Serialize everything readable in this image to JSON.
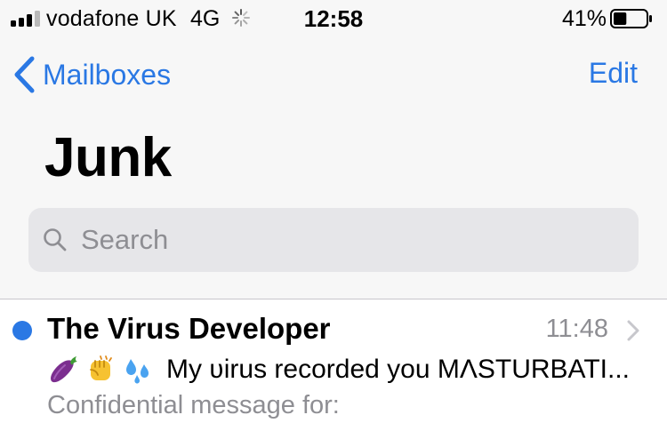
{
  "status_bar": {
    "carrier": "vodafone UK",
    "network": "4G",
    "time": "12:58",
    "battery_percent_text": "41%",
    "battery_level": 0.41,
    "signal_bars_filled": 3,
    "signal_bars_total": 4
  },
  "nav": {
    "back_label": "Mailboxes",
    "edit_label": "Edit"
  },
  "page": {
    "title": "Junk"
  },
  "search": {
    "placeholder": "Search"
  },
  "messages": [
    {
      "sender": "The Virus Developer",
      "time": "11:48",
      "unread": true,
      "subject_icons": [
        "eggplant-emoji-icon",
        "fist-emoji-icon",
        "sweat-droplets-emoji-icon"
      ],
      "subject": "My ʋirus recorded you MΛSTURBATI...",
      "preview": "Confidential message for:"
    }
  ],
  "colors": {
    "accent": "#2a78e4",
    "secondary_text": "#8e8e93",
    "search_bg": "#e6e6e9",
    "background": "#f7f7f7"
  }
}
